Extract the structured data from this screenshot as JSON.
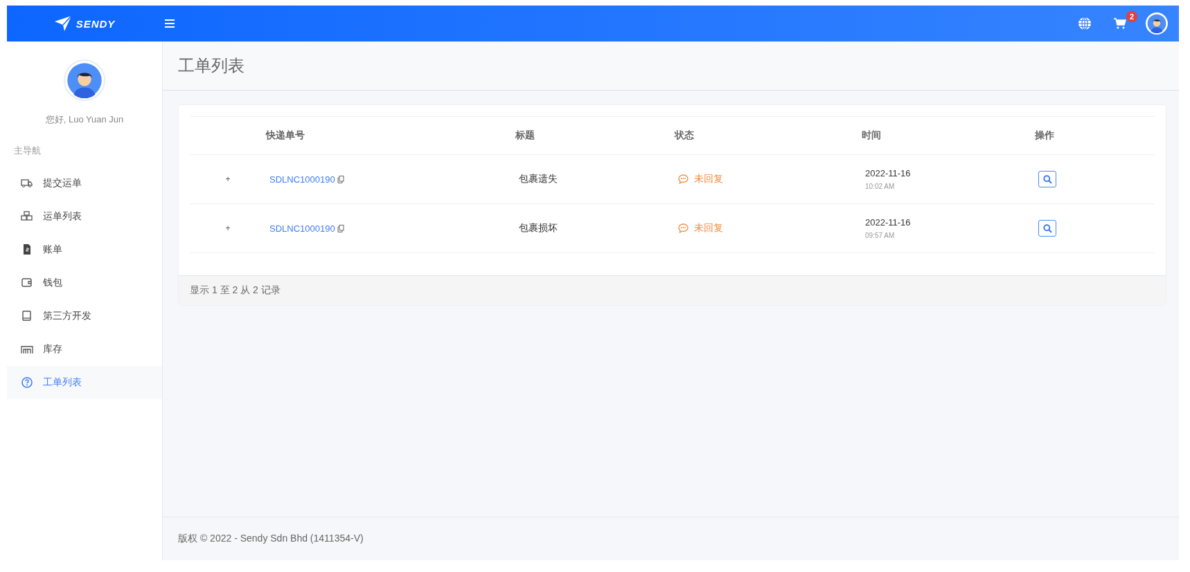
{
  "topbar": {
    "logo": "SENDY",
    "cart_badge": "2"
  },
  "sidebar": {
    "greeting": "您好, Luo Yuan Jun",
    "section": "主导航",
    "items": [
      {
        "label": "提交运单",
        "selected": false
      },
      {
        "label": "运单列表",
        "selected": false
      },
      {
        "label": "账单",
        "selected": false
      },
      {
        "label": "钱包",
        "selected": false
      },
      {
        "label": "第三方开发",
        "selected": false
      },
      {
        "label": "库存",
        "selected": false
      },
      {
        "label": "工单列表",
        "selected": true
      }
    ]
  },
  "page": {
    "title": "工单列表"
  },
  "table": {
    "columns": [
      "快递单号",
      "标题",
      "状态",
      "时间",
      "操作"
    ],
    "rows": [
      {
        "expander": "+",
        "tracking": "SDLNC1000190",
        "title": "包裹遗失",
        "status": "未回复",
        "date": "2022-11-16",
        "time": "10:02 AM"
      },
      {
        "expander": "+",
        "tracking": "SDLNC1000190",
        "title": "包裹损坏",
        "status": "未回复",
        "date": "2022-11-16",
        "time": "09:57 AM"
      }
    ],
    "summary": "显示 1 至 2 从 2 记录"
  },
  "footer": "版权 © 2022 - Sendy Sdn Bhd (1411354-V)"
}
